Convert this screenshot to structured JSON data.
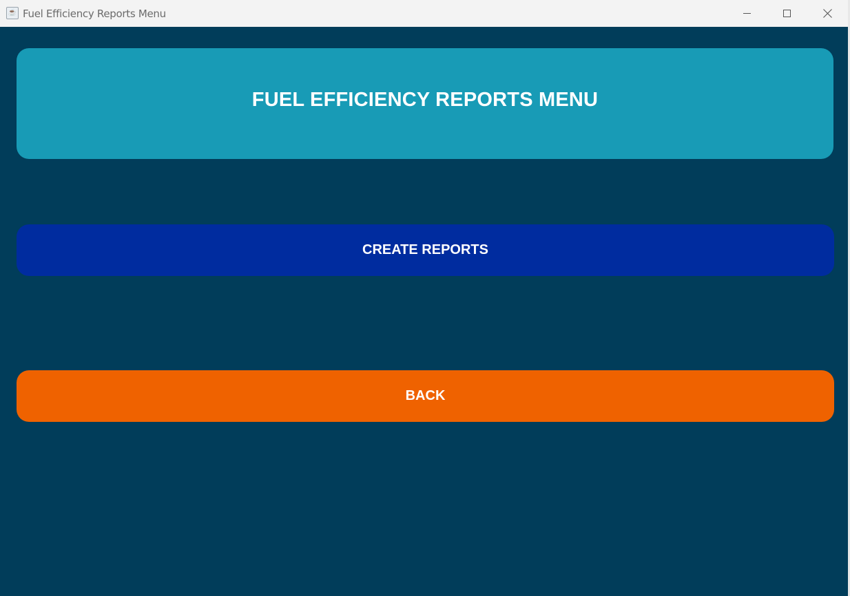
{
  "window": {
    "title": "Fuel Efficiency Reports Menu",
    "app_icon": "java-app-icon"
  },
  "header": {
    "title": "FUEL EFFICIENCY REPORTS MENU"
  },
  "buttons": {
    "create_reports": "CREATE REPORTS",
    "back": "BACK"
  },
  "colors": {
    "background": "#013d5a",
    "header_panel": "#189bb6",
    "create_button": "#002c9f",
    "back_button": "#ef6200",
    "text": "#ffffff"
  }
}
